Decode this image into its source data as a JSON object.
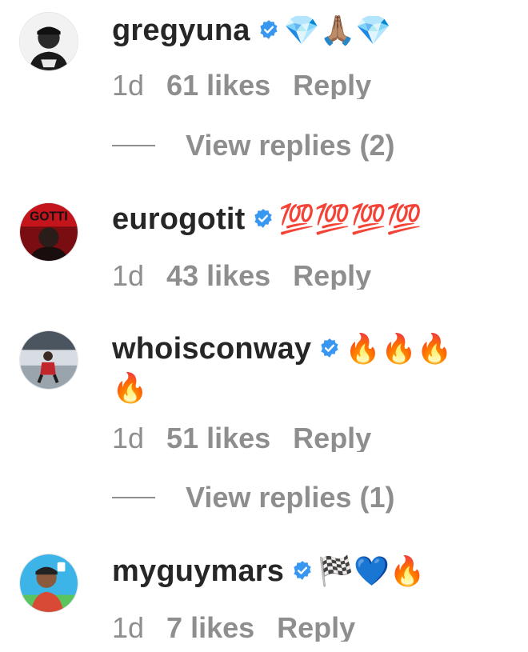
{
  "comments": [
    {
      "username": "gregyuna",
      "verified": true,
      "text": "💎🙏🏽💎",
      "time": "1d",
      "likes": "61 likes",
      "reply_label": "Reply",
      "view_replies": "View replies (2)"
    },
    {
      "username": "eurogotit",
      "verified": true,
      "text": "💯💯💯💯",
      "time": "1d",
      "likes": "43 likes",
      "reply_label": "Reply"
    },
    {
      "username": "whoisconway",
      "verified": true,
      "text": "🔥🔥🔥",
      "text_line2": "🔥",
      "time": "1d",
      "likes": "51 likes",
      "reply_label": "Reply",
      "view_replies": "View replies (1)"
    },
    {
      "username": "myguymars",
      "verified": true,
      "text": "🏁💙🔥",
      "time": "1d",
      "likes": "7 likes",
      "reply_label": "Reply"
    }
  ],
  "colors": {
    "verified_badge": "#3897f0",
    "meta_text": "#8e8e8e",
    "username": "#262626"
  },
  "icons": {
    "verified": "verified-badge-icon"
  }
}
